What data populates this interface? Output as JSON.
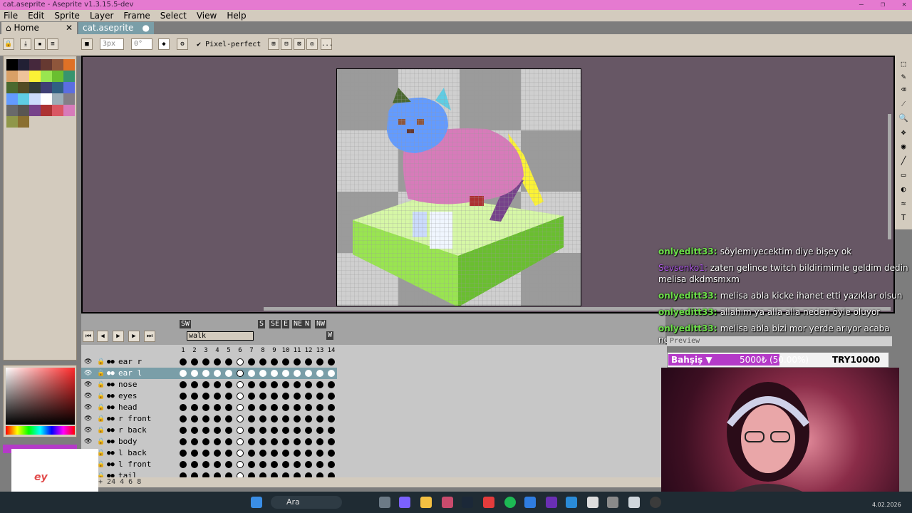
{
  "window": {
    "title": "cat.aseprite - Aseprite v1.3.15.5-dev",
    "buttons": [
      "—",
      "❐",
      "✕"
    ]
  },
  "menu": [
    "File",
    "Edit",
    "Sprite",
    "Layer",
    "Frame",
    "Select",
    "View",
    "Help"
  ],
  "tabs": [
    {
      "label": "Home",
      "close": "✕"
    },
    {
      "label": "cat.aseprite",
      "close": "●"
    }
  ],
  "toolbar": {
    "brush_size": "3px",
    "angle": "0°",
    "pixel_perfect_label": "Pixel-perfect",
    "pixel_perfect_mark": "✔",
    "more": "..."
  },
  "palette": [
    "#000000",
    "#222034",
    "#45283c",
    "#663931",
    "#8f563b",
    "#df7126",
    "#d9a066",
    "#eec39a",
    "#fbf236",
    "#99e550",
    "#6abe30",
    "#37946e",
    "#4b692f",
    "#524b24",
    "#323c39",
    "#3f3f74",
    "#306082",
    "#5b6ee1",
    "#639bff",
    "#5fcde4",
    "#cbdbfc",
    "#ffffff",
    "#9badb7",
    "#847e87",
    "#696a6a",
    "#595652",
    "#76428a",
    "#ac3232",
    "#d95763",
    "#d77bba",
    "#8f974a",
    "#8a6f30"
  ],
  "timeline": {
    "tags": [
      {
        "label": "SW",
        "dark": true
      },
      {
        "label": "walk",
        "dark": false
      },
      {
        "label": "S",
        "dark": true
      },
      {
        "label": "SE",
        "dark": true
      },
      {
        "label": "E",
        "dark": true
      },
      {
        "label": "NE",
        "dark": true
      },
      {
        "label": "N",
        "dark": true
      },
      {
        "label": "NW",
        "dark": true
      },
      {
        "label": "W",
        "dark": true
      }
    ],
    "frames": [
      "1",
      "2",
      "3",
      "4",
      "5",
      "6",
      "7",
      "8",
      "9",
      "10",
      "11",
      "12",
      "13",
      "14"
    ],
    "layers": [
      "ear r",
      "ear l",
      "nose",
      "eyes",
      "head",
      "r front",
      "r back",
      "body",
      "l back",
      "l front",
      "tail"
    ],
    "selected_layer": "ear l",
    "status": "24 4 6 8"
  },
  "chat": [
    {
      "user": "onlyeditt33:",
      "text": "söylemiyecektim diye bişey ok",
      "color": "green"
    },
    {
      "user": "Sevsenko1:",
      "text": "zaten gelince twitch bildirimimle geldim dedin melisa dkdmsmxm",
      "color": "purple"
    },
    {
      "user": "onlyeditt33:",
      "text": "melisa abla kicke ihanet etti yazıklar olsun",
      "color": "green"
    },
    {
      "user": "onlyeditt33:",
      "text": "allahım ya alla alla neden öyle oluyor",
      "color": "green"
    },
    {
      "user": "onlyeditt33:",
      "text": "melisa abla bizi mor yerde arıyor acaba neden",
      "color": "green"
    }
  ],
  "preview": {
    "header": "Preview"
  },
  "donation": {
    "title": "Bahşiş ▼",
    "current": "5000₺ (50.00%)",
    "goal": "TRY10000",
    "progress": 0.5
  },
  "overlay_logo": "ey",
  "taskbar": {
    "search": "Ara",
    "date": "4.02.2026"
  }
}
